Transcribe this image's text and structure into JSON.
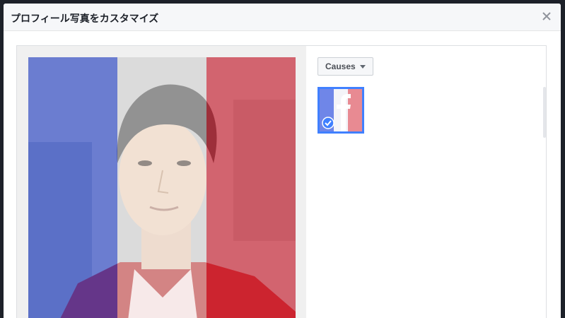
{
  "dialog": {
    "title": "プロフィール写真をカスタマイズ"
  },
  "frames": {
    "filter_label": "Causes",
    "selected_frame_icon": "facebook-f-flag-icon",
    "selected": true
  },
  "colors": {
    "flag_blue": "#2848e0",
    "flag_white": "#ffffff",
    "flag_red": "#e0283a",
    "selection_border": "#4080ff",
    "header_bg": "#f6f7f9"
  }
}
